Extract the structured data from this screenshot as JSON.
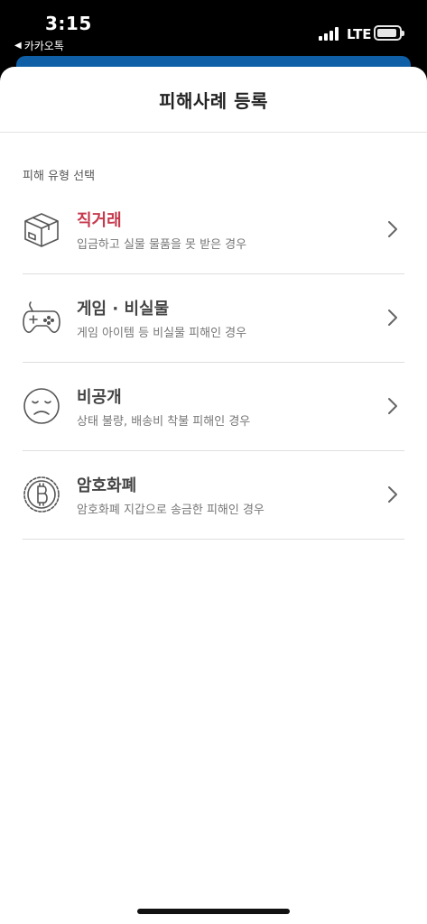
{
  "status_bar": {
    "time": "3:15",
    "back_app": "카카오톡",
    "network": "LTE"
  },
  "sheet": {
    "title": "피해사례 등록",
    "section_label": "피해 유형 선택",
    "items": [
      {
        "title": "직거래",
        "desc": "입금하고 실물 물품을 못 받은 경우",
        "icon": "box-icon",
        "title_color": "#c6394d"
      },
      {
        "title": "게임 · 비실물",
        "desc": "게임 아이템 등 비실물 피해인 경우",
        "icon": "gamepad-icon",
        "title_color": "#444444"
      },
      {
        "title": "비공개",
        "desc": "상태 불량, 배송비 착불 피해인 경우",
        "icon": "sad-face-icon",
        "title_color": "#444444"
      },
      {
        "title": "암호화폐",
        "desc": "암호화폐 지갑으로 송금한 피해인 경우",
        "icon": "bitcoin-icon",
        "title_color": "#444444"
      }
    ]
  }
}
